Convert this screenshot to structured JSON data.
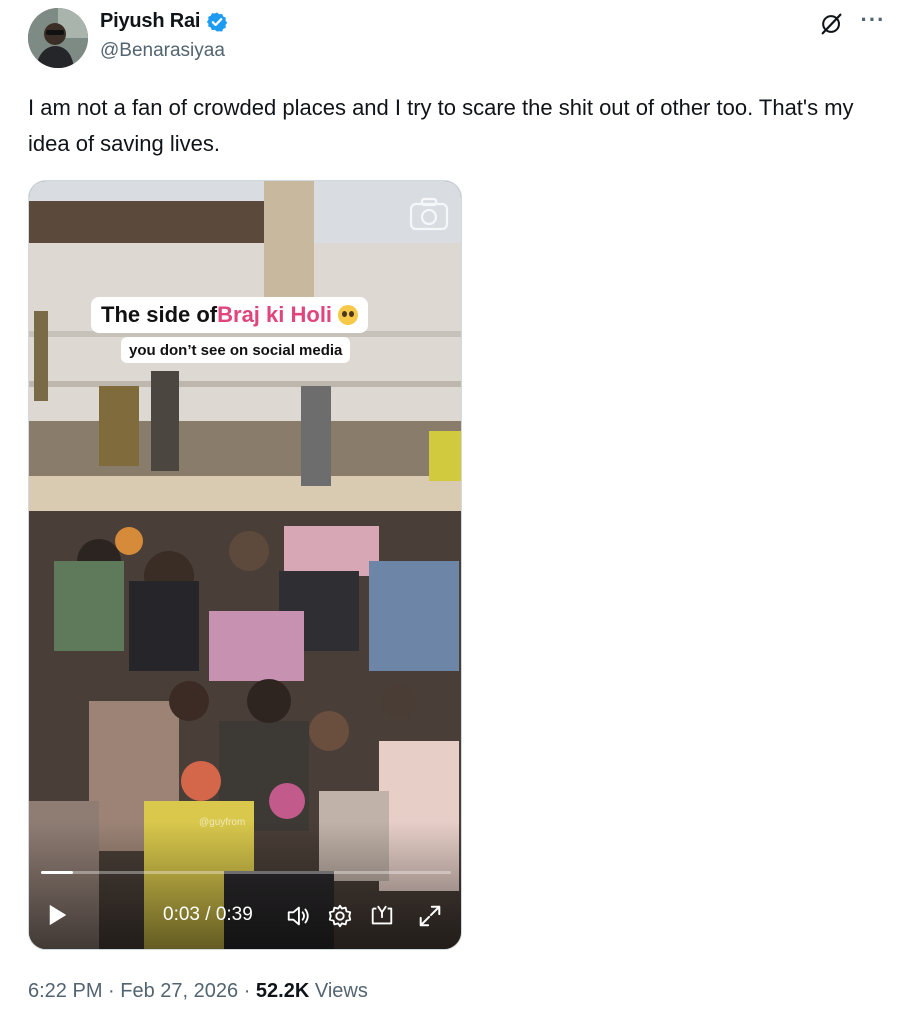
{
  "author": {
    "display_name": "Piyush Rai",
    "handle": "@Benarasiyaa",
    "verified": true,
    "verified_color": "#1d9bf0"
  },
  "header_actions": {
    "grok_icon": "grok-icon",
    "more_icon": "more-icon",
    "more_label": "···"
  },
  "tweet": {
    "text": "I am not a fan of crowded places and I try to scare the shit out of other too. That's my idea of saving lives."
  },
  "media": {
    "type": "video",
    "caption_main_prefix": "The side of ",
    "caption_main_accent": "Braj ki Holi",
    "caption_sub": "you don’t see on social media",
    "watermark": "@guyfrom",
    "accent_color": "#e0457b",
    "player": {
      "time_display": "0:03 / 0:39",
      "progress_fraction": 0.077,
      "icons": [
        "play-icon",
        "volume-icon",
        "settings-icon",
        "pip-icon",
        "fullscreen-icon"
      ]
    }
  },
  "meta": {
    "time": "6:22 PM",
    "sep1": " · ",
    "date": "Feb 27, 2026",
    "sep2": " · ",
    "views_count": "52.2K",
    "views_label": " Views"
  }
}
